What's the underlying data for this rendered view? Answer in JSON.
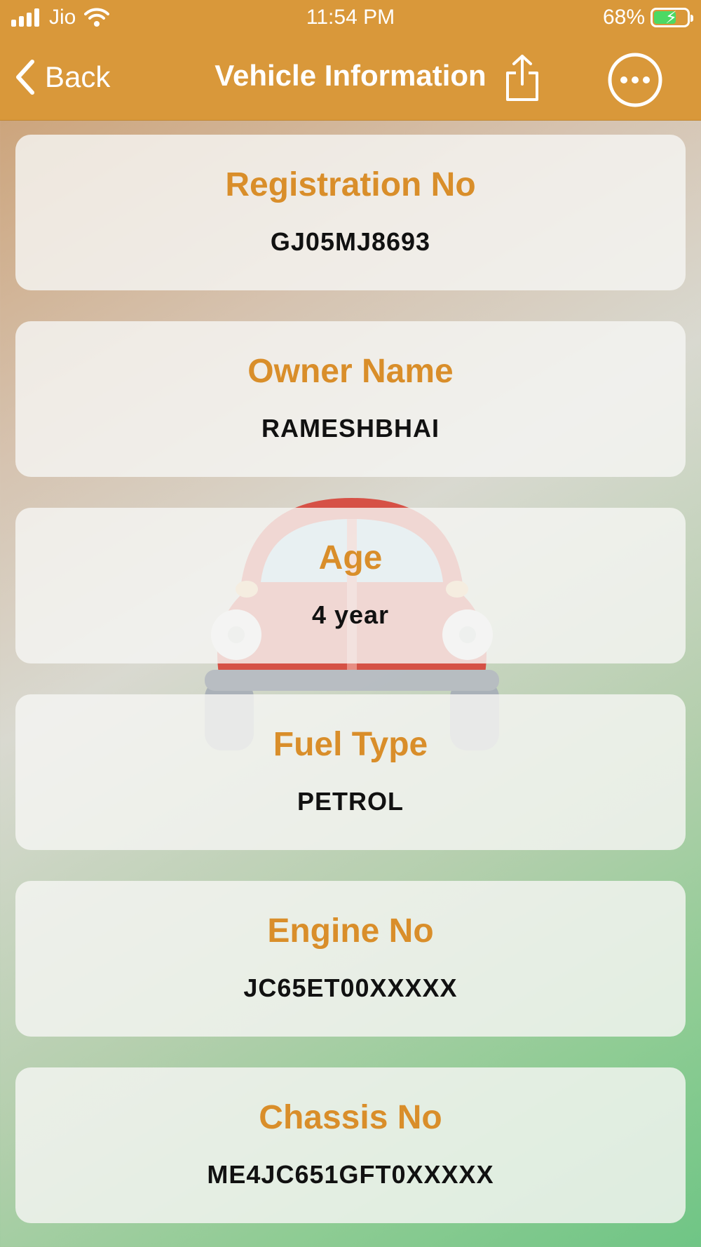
{
  "status_bar": {
    "carrier": "Jio",
    "time": "11:54 PM",
    "battery_percent": "68%",
    "battery_level": 0.68,
    "icons": [
      "cellular-signal-icon",
      "wifi-icon",
      "battery-charging-icon"
    ]
  },
  "nav": {
    "back_label": "Back",
    "title": "Vehicle Information",
    "icons": [
      "chevron-left-icon",
      "share-icon",
      "more-options-icon"
    ]
  },
  "colors": {
    "nav_background": "#d9983a",
    "label": "#d98e2a",
    "value": "#111111",
    "card_background": "#f5f5f3"
  },
  "cards": [
    {
      "label": "Registration No",
      "value": "GJ05MJ8693"
    },
    {
      "label": "Owner Name",
      "value": "RAMESHBHAI"
    },
    {
      "label": "Age",
      "value": "4 year"
    },
    {
      "label": "Fuel Type",
      "value": "PETROL"
    },
    {
      "label": "Engine No",
      "value": "JC65ET00XXXXX"
    },
    {
      "label": "Chassis No",
      "value": "ME4JC651GFT0XXXXX"
    }
  ]
}
